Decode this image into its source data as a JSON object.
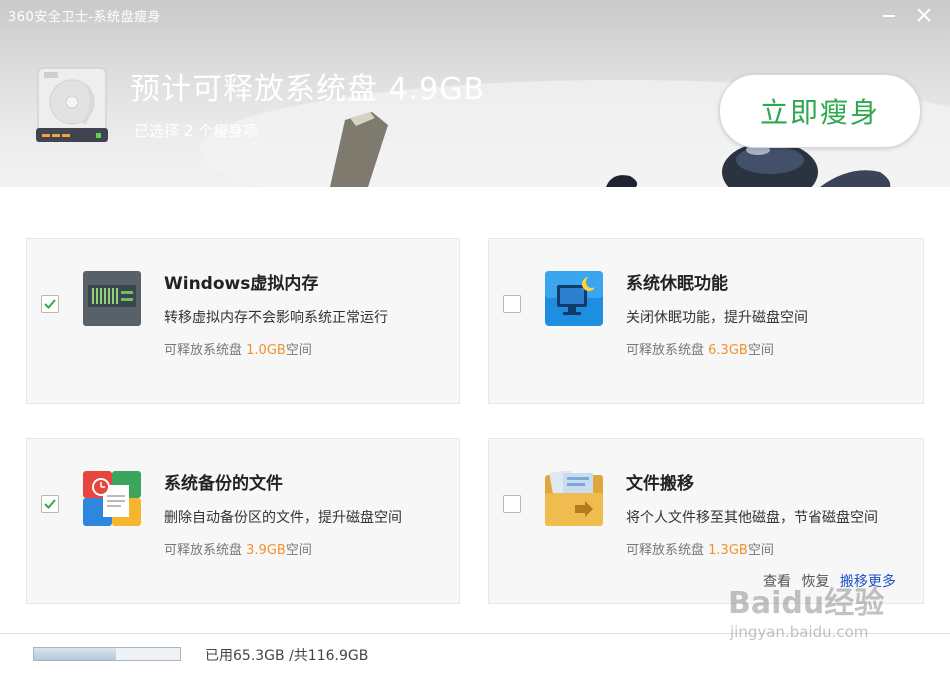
{
  "window": {
    "title": "360安全卫士-系统盘瘦身",
    "minimize_icon": "minimize-icon",
    "close_icon": "close-icon"
  },
  "header": {
    "headline": "预计可释放系统盘 4.9GB",
    "selected_text": "已选择 2 个瘦身项",
    "slim_button": "立即瘦身",
    "accent_color": "#2fa84f"
  },
  "cards": [
    {
      "checked": true,
      "icon": "memory-chip-icon",
      "title": "Windows虚拟内存",
      "desc": "转移虚拟内存不会影响系统正常运行",
      "free_prefix": "可释放系统盘 ",
      "free_amount": "1.0GB",
      "free_suffix": "空间"
    },
    {
      "checked": false,
      "icon": "hibernate-monitor-icon",
      "title": "系统休眠功能",
      "desc": "关闭休眠功能，提升磁盘空间",
      "free_prefix": "可释放系统盘 ",
      "free_amount": "6.3GB",
      "free_suffix": "空间"
    },
    {
      "checked": true,
      "icon": "backup-files-icon",
      "title": "系统备份的文件",
      "desc": "删除自动备份区的文件，提升磁盘空间",
      "free_prefix": "可释放系统盘 ",
      "free_amount": "3.9GB",
      "free_suffix": "空间"
    },
    {
      "checked": false,
      "icon": "file-folder-move-icon",
      "title": "文件搬移",
      "desc": "将个人文件移至其他磁盘，节省磁盘空间",
      "free_prefix": "可释放系统盘 ",
      "free_amount": "1.3GB",
      "free_suffix": "空间",
      "links": {
        "view": "查看",
        "restore": "恢复",
        "more": "搬移更多"
      }
    }
  ],
  "footer": {
    "disk_usage_text": "已用65.3GB /共116.9GB",
    "used_fraction": 0.559
  },
  "watermark": {
    "brand": "Baidu经验",
    "url": "jingyan.baidu.com"
  },
  "colors": {
    "amount_orange": "#f0922b",
    "link_blue": "#1e50c8",
    "check_green": "#3aa845"
  }
}
